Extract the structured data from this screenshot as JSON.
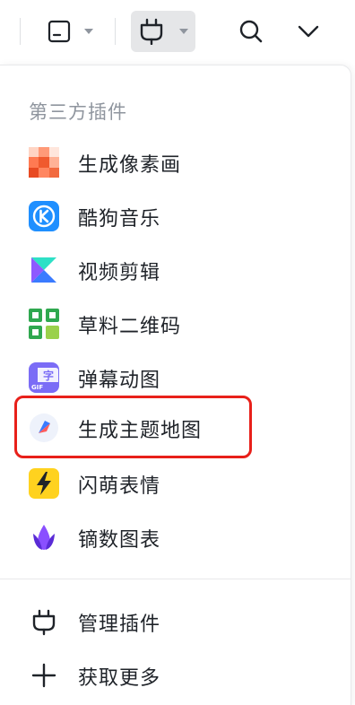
{
  "section_title": "第三方插件",
  "plugins": [
    {
      "label": "生成像素画",
      "icon": "pixel-art-icon"
    },
    {
      "label": "酷狗音乐",
      "icon": "kugou-music-icon"
    },
    {
      "label": "视频剪辑",
      "icon": "video-edit-icon"
    },
    {
      "label": "草料二维码",
      "icon": "qr-code-icon"
    },
    {
      "label": "弹幕动图",
      "icon": "danmaku-gif-icon"
    },
    {
      "label": "生成主题地图",
      "icon": "theme-map-icon"
    },
    {
      "label": "闪萌表情",
      "icon": "lightning-sticker-icon"
    },
    {
      "label": "镝数图表",
      "icon": "dyclub-chart-icon"
    }
  ],
  "footer": [
    {
      "label": "管理插件",
      "icon": "plug-icon"
    },
    {
      "label": "获取更多",
      "icon": "plus-icon"
    }
  ],
  "colors": {
    "highlight": "#e8201a",
    "kugou_blue": "#1f8fff",
    "qr_green": "#2fa84f",
    "lightning_yellow": "#ffd21f"
  }
}
